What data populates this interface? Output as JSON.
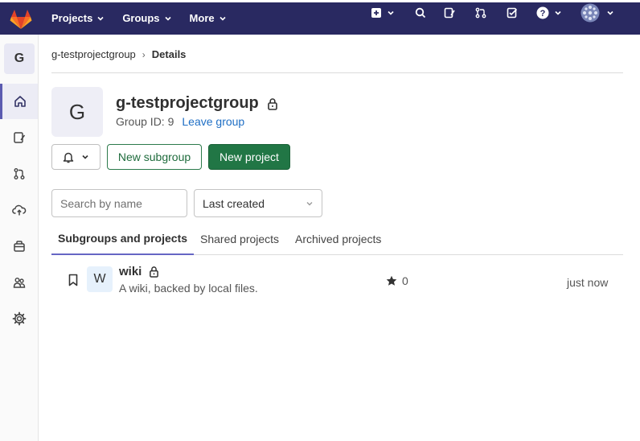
{
  "topbar": {
    "nav": [
      "Projects",
      "Groups",
      "More"
    ],
    "icons": [
      "plus-square-icon",
      "search-icon",
      "issues-icon",
      "merge-request-icon",
      "todo-icon",
      "help-icon",
      "user-avatar"
    ],
    "colors": {
      "background": "#292961",
      "logo_orange": "#e24329"
    }
  },
  "sidebar": {
    "avatar_letter": "G",
    "items": [
      "home-icon",
      "issues-icon",
      "merge-request-icon",
      "deploy-cloud-icon",
      "packages-icon",
      "members-icon",
      "settings-icon"
    ],
    "active": "home-icon"
  },
  "breadcrumb": {
    "parent": "g-testprojectgroup",
    "current": "Details"
  },
  "group": {
    "avatar_letter": "G",
    "name": "g-testprojectgroup",
    "id_text": "Group ID: 9",
    "leave_label": "Leave group"
  },
  "actions": {
    "new_subgroup": "New subgroup",
    "new_project": "New project"
  },
  "filters": {
    "search_placeholder": "Search by name",
    "sort_value": "Last created"
  },
  "tabs": [
    {
      "label": "Subgroups and projects",
      "active": true
    },
    {
      "label": "Shared projects",
      "active": false
    },
    {
      "label": "Archived projects",
      "active": false
    }
  ],
  "projects": [
    {
      "avatar_letter": "W",
      "name": "wiki",
      "description": "A wiki, backed by local files.",
      "stars": "0",
      "updated": "just now"
    }
  ]
}
